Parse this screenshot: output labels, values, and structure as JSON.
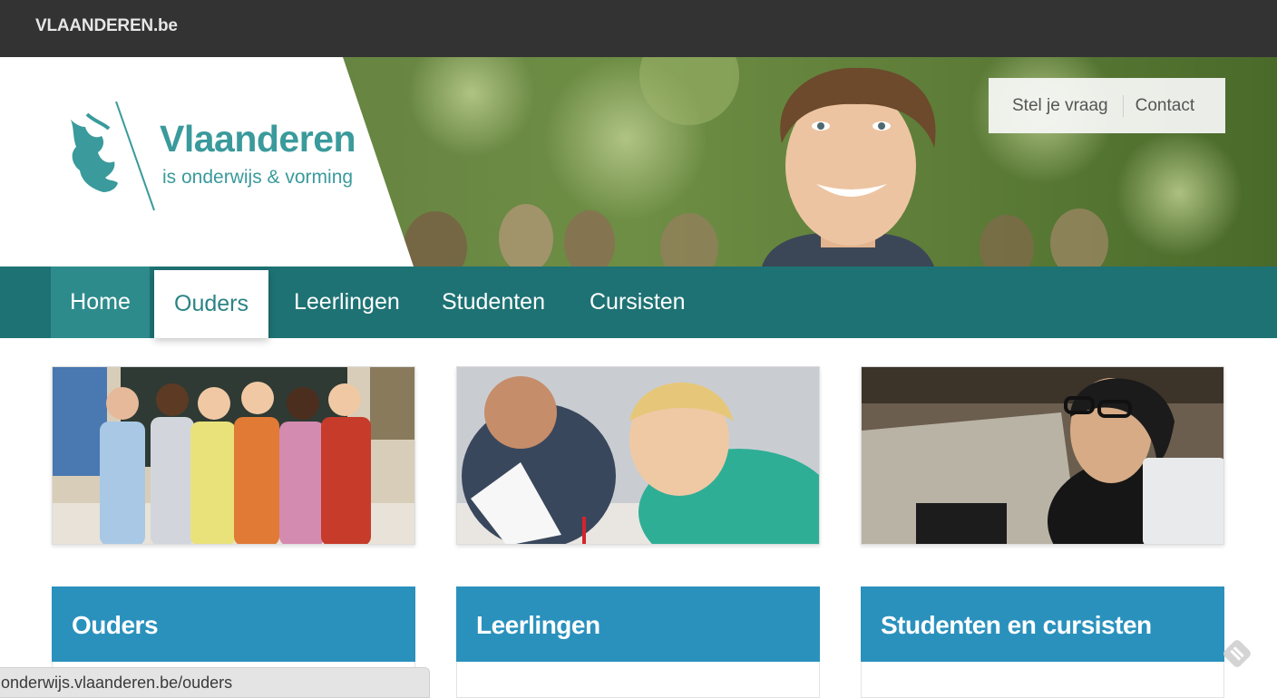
{
  "topbar": {
    "brand": "VLAANDEREN.be"
  },
  "logo": {
    "title": "Vlaanderen",
    "subtitle": "is onderwijs & vorming",
    "icon": "lion-icon",
    "color": "#3a9a9c"
  },
  "quicklinks": [
    {
      "label": "Stel je vraag"
    },
    {
      "label": "Contact"
    }
  ],
  "nav": {
    "items": [
      {
        "label": "Home"
      },
      {
        "label": "Ouders",
        "active": true
      },
      {
        "label": "Leerlingen"
      },
      {
        "label": "Studenten"
      },
      {
        "label": "Cursisten"
      }
    ],
    "bg_color": "#1e7274",
    "active_text_color": "#2b8385"
  },
  "cards": [
    {
      "title": "Ouders",
      "image": "children-in-classroom-photo"
    },
    {
      "title": "Leerlingen",
      "image": "students-taking-exam-photo"
    },
    {
      "title": "Studenten en cursisten",
      "image": "student-with-laptop-photo"
    }
  ],
  "card_header_color": "#2a91bd",
  "statusbar": {
    "url": "onderwijs.vlaanderen.be/ouders"
  },
  "feedly_icon": "feedly-icon"
}
